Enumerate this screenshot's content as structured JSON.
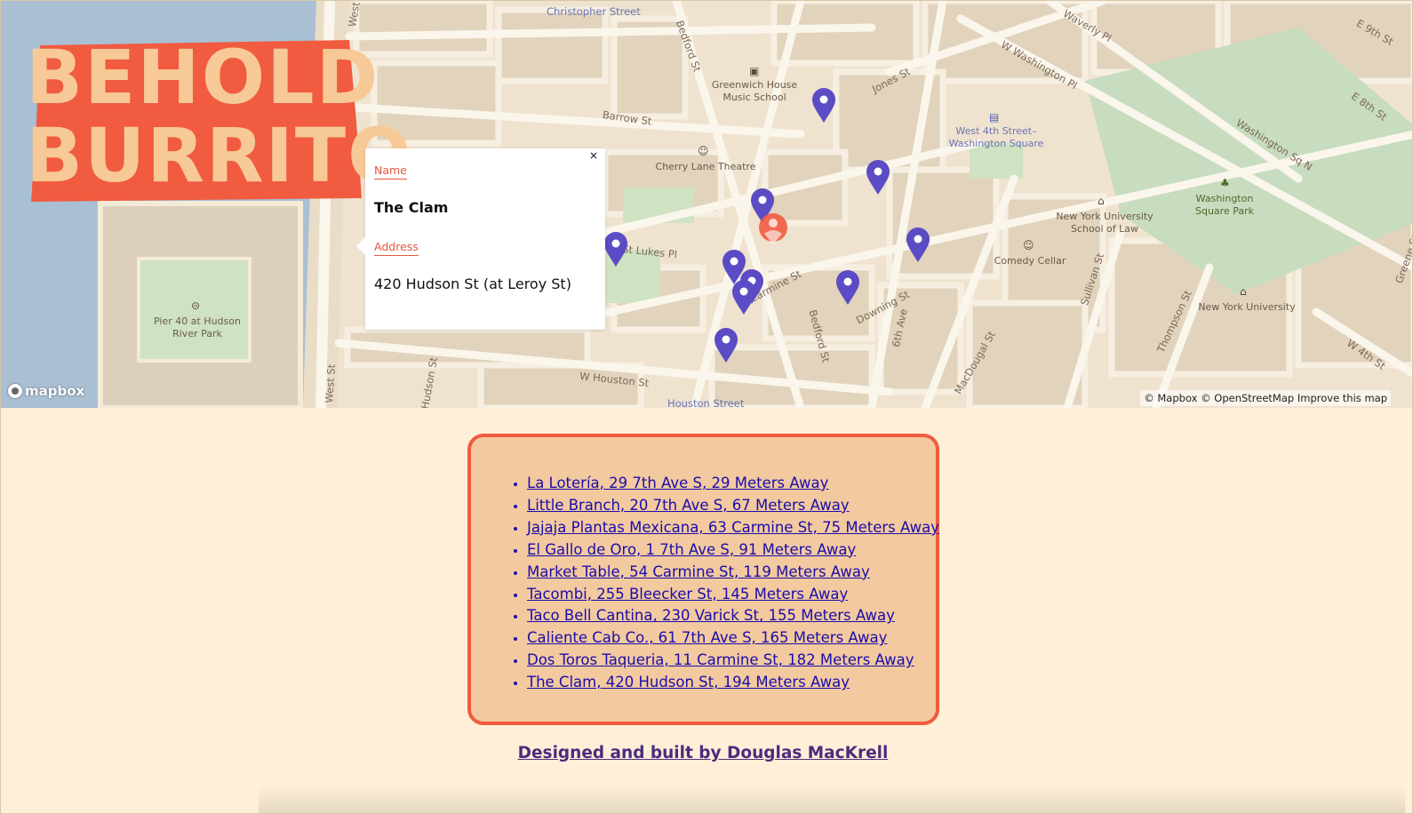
{
  "logo": {
    "line1": "BEHOLD",
    "line2": "BURRITO"
  },
  "popup": {
    "close_label": "×",
    "name_label": "Name",
    "name_value": "The Clam",
    "address_label": "Address",
    "address_value": "420 Hudson St (at Leroy St)"
  },
  "map": {
    "street_labels": [
      "West St",
      "Christopher Street",
      "Bedford St",
      "Barrow St",
      "Jones St",
      "W Washington Pl",
      "Waverly Pl",
      "E 9th St",
      "E 8th St",
      "Washington Sq N",
      "St Lukes Pl",
      "Carmine St",
      "Downing St",
      "Bedford St",
      "6th Ave",
      "MacDougal St",
      "Sullivan St",
      "Thompson St",
      "W 4th St",
      "Greene St",
      "W Houston St",
      "Hudson St",
      "West St",
      "Houston Street"
    ],
    "poi_labels": {
      "greenwich_house": "Greenwich House\nMusic School",
      "cherry_lane": "Cherry Lane Theatre",
      "west4th": "West 4th Street–\nWashington Square",
      "washington_square": "Washington\nSquare Park",
      "nyu_law": "New York University\nSchool of Law",
      "comedy_cellar": "Comedy Cellar",
      "nyu": "New York University",
      "pier40": "Pier 40 at Hudson\nRiver Park"
    },
    "mapbox_logo": "mapbox",
    "attribution": {
      "mapbox": "© Mapbox",
      "osm": "© OpenStreetMap",
      "improve": "Improve this map"
    },
    "pin_color": "#5b4bc4",
    "active_pin_color": "#f15b40",
    "water_color": "#a9bfd4"
  },
  "results": [
    "La Lotería, 29 7th Ave S, 29 Meters Away",
    "Little Branch, 20 7th Ave S, 67 Meters Away",
    "Jajaja Plantas Mexicana, 63 Carmine St, 75 Meters Away",
    "El Gallo de Oro, 1 7th Ave S, 91 Meters Away",
    "Market Table, 54 Carmine St, 119 Meters Away",
    "Tacombi, 255 Bleecker St, 145 Meters Away",
    "Taco Bell Cantina, 230 Varick St, 155 Meters Away",
    "Caliente Cab Co., 61 7th Ave S, 165 Meters Away",
    "Dos Toros Taqueria, 11 Carmine St, 182 Meters Away",
    "The Clam, 420 Hudson St, 194 Meters Away"
  ],
  "footer": {
    "credit": "Designed and built by Douglas MacKrell"
  },
  "colors": {
    "page_bg": "#fef0d8",
    "list_bg": "#f3c99f",
    "list_border": "#f15b40",
    "link": "#1a0dab",
    "footer_link": "#4b2c7d"
  }
}
